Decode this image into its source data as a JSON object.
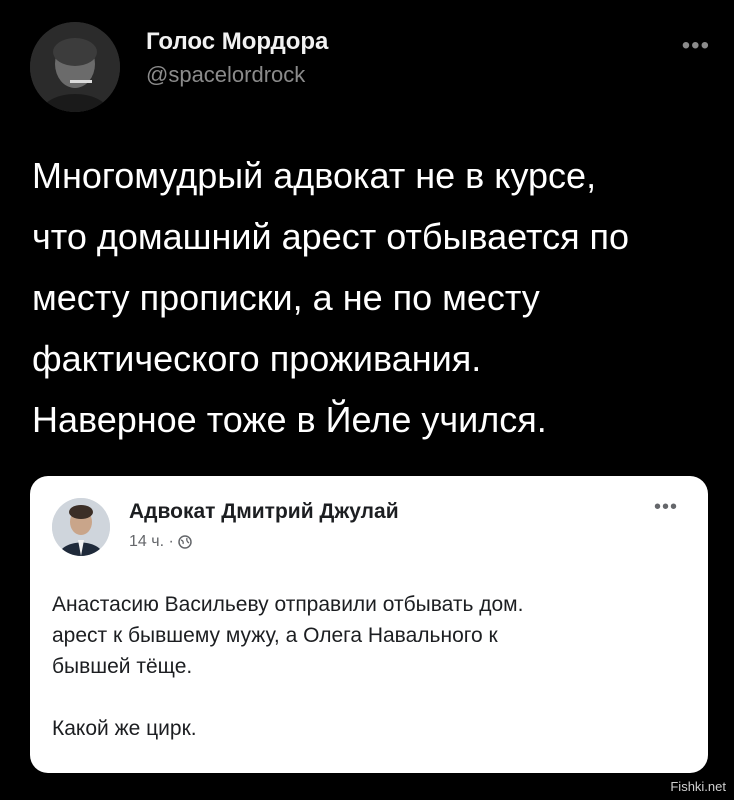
{
  "tweet": {
    "author_name": "Голос Мордора",
    "author_handle": "@spacelordrock",
    "more_icon": "more-horizontal-icon",
    "text": "Многомудрый адвокат не в курсе,\nчто домашний арест отбывается по\nместу прописки, а не по месту\nфактического проживания.\nНаверное тоже в Йеле учился."
  },
  "embedded_post": {
    "author_name": "Адвокат Дмитрий Джулай",
    "time": "14 ч. ·",
    "privacy_icon": "globe-icon",
    "more_icon": "more-horizontal-icon",
    "text": "Анастасию Васильеву отправили отбывать дом.\nарест к бывшему мужу, а Олега Навального к\nбывшей тёще.\n\nКакой же цирк."
  },
  "watermark": "Fishki.net",
  "colors": {
    "background": "#000000",
    "card": "#ffffff",
    "handle": "#8b8b8b",
    "meta": "#65676b"
  }
}
